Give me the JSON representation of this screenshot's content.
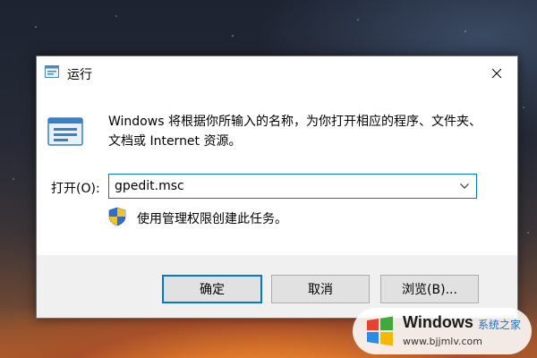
{
  "window": {
    "title": "运行",
    "icon": "run-app-icon",
    "close_icon": "close-icon"
  },
  "content": {
    "description": "Windows 将根据你所输入的名称，为你打开相应的程序、文件夹、文档或 Internet 资源。",
    "open_label": "打开(O):",
    "command_value": "gpedit.msc",
    "dropdown_icon": "chevron-down-icon",
    "admin_note": "使用管理权限创建此任务。",
    "shield_icon": "uac-shield-icon"
  },
  "buttons": {
    "ok": "确定",
    "cancel": "取消",
    "browse": "浏览(B)..."
  },
  "watermark": {
    "title": "Windows",
    "subtitle": "系统之家",
    "url": "www.bjjmlv.com"
  },
  "colors": {
    "accent": "#0078d7",
    "dialog_bg": "#f0f0f0",
    "button_bg": "#e1e1e1"
  }
}
